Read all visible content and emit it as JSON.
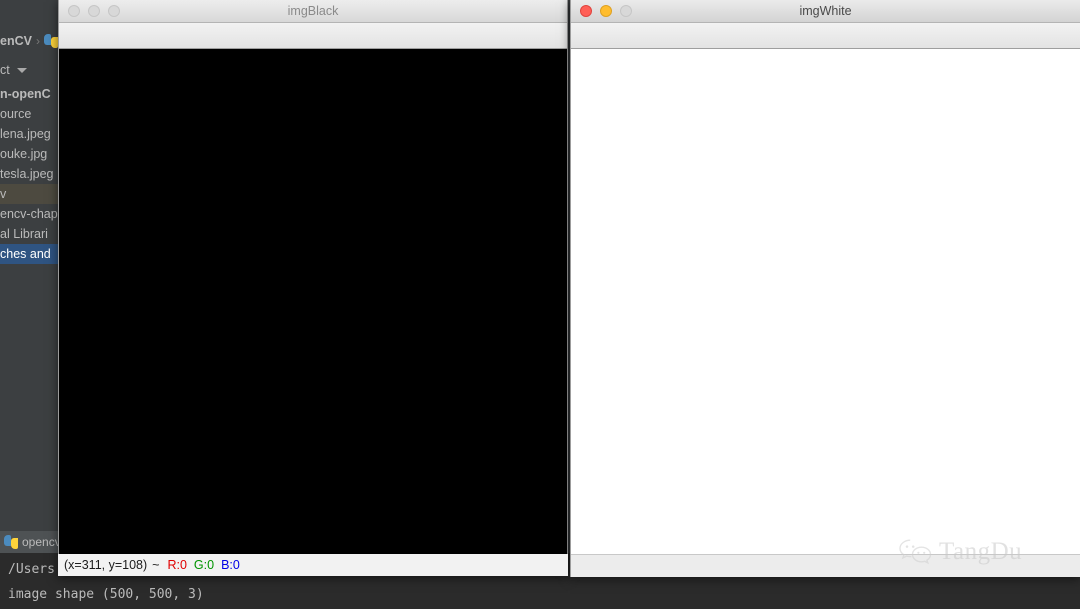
{
  "ide": {
    "breadcrumb": {
      "project_label": "enCV",
      "separator": "›",
      "file_icon": "python-file-icon"
    },
    "project_header": {
      "label": "ct"
    },
    "project_tree": [
      {
        "label": "n-openC",
        "style": "bold"
      },
      {
        "label": "ource",
        "style": "normal"
      },
      {
        "label": "lena.jpeg",
        "style": "normal"
      },
      {
        "label": "ouke.jpg",
        "style": "normal"
      },
      {
        "label": "tesla.jpeg",
        "style": "normal"
      },
      {
        "label": "v",
        "style": "highlight-tan"
      },
      {
        "label": "encv-chap",
        "style": "normal"
      },
      {
        "label": "al Librari",
        "style": "normal"
      },
      {
        "label": "ches and ",
        "style": "selected-blue"
      }
    ],
    "run_panel": {
      "tab_label": "opencv",
      "tab_icon": "python-file-icon",
      "console_lines": [
        "/Users",
        "image shape (500, 500, 3)"
      ]
    }
  },
  "windows": [
    {
      "id": "imgBlack",
      "title": "imgBlack",
      "active": false,
      "canvas_color": "#000000",
      "traffic_lights": [
        "close",
        "minimize",
        "zoom"
      ]
    },
    {
      "id": "imgWhite",
      "title": "imgWhite",
      "active": true,
      "canvas_color": "#ffffff",
      "traffic_lights": [
        "close",
        "minimize",
        "zoom"
      ]
    }
  ],
  "pixel_readout": {
    "coords": "(x=311, y=108)",
    "tilde": "~",
    "r_label": "R:0",
    "g_label": "G:0",
    "b_label": "B:0",
    "r_color": "#e00000",
    "g_color": "#009400",
    "b_color": "#0000e6"
  },
  "watermark": {
    "text": "TangDu",
    "icon": "wechat-icon"
  }
}
